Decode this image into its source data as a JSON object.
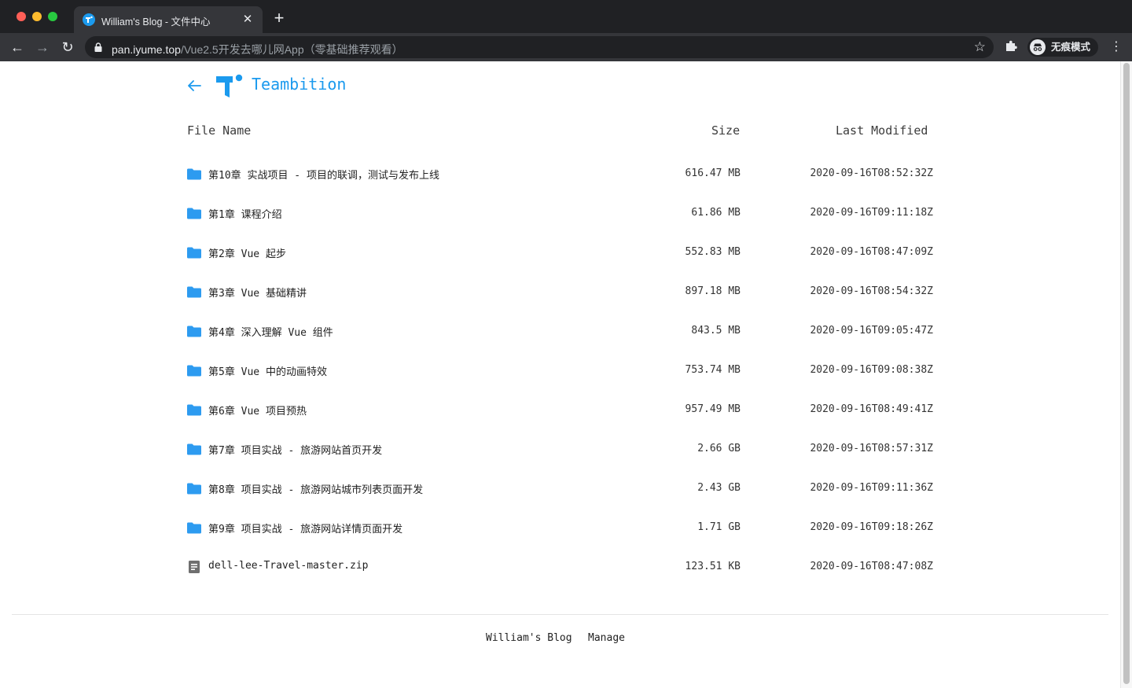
{
  "browser": {
    "tab_title": "William's Blog - 文件中心",
    "tab_close": "✕",
    "new_tab": "+",
    "url_host": "pan.iyume.top",
    "url_path": "/Vue2.5开发去哪儿网App（零基础推荐观看）",
    "incognito_label": "无痕模式",
    "back_glyph": "←",
    "forward_glyph": "→",
    "reload_glyph": "↻",
    "star_glyph": "☆",
    "menu_glyph": "⋮"
  },
  "header": {
    "brand": "Teambition",
    "accent_color": "#1b9aee"
  },
  "table": {
    "col_name": "File Name",
    "col_size": "Size",
    "col_modified": "Last Modified"
  },
  "files": [
    {
      "name": "第10章 实战项目 - 项目的联调，测试与发布上线",
      "size": "616.47 MB",
      "modified": "2020-09-16T08:52:32Z",
      "type": "folder"
    },
    {
      "name": "第1章 课程介绍",
      "size": "61.86 MB",
      "modified": "2020-09-16T09:11:18Z",
      "type": "folder"
    },
    {
      "name": "第2章 Vue 起步",
      "size": "552.83 MB",
      "modified": "2020-09-16T08:47:09Z",
      "type": "folder"
    },
    {
      "name": "第3章 Vue 基础精讲",
      "size": "897.18 MB",
      "modified": "2020-09-16T08:54:32Z",
      "type": "folder"
    },
    {
      "name": "第4章 深入理解 Vue 组件",
      "size": "843.5 MB",
      "modified": "2020-09-16T09:05:47Z",
      "type": "folder"
    },
    {
      "name": "第5章 Vue 中的动画特效",
      "size": "753.74 MB",
      "modified": "2020-09-16T09:08:38Z",
      "type": "folder"
    },
    {
      "name": "第6章 Vue 项目预热",
      "size": "957.49 MB",
      "modified": "2020-09-16T08:49:41Z",
      "type": "folder"
    },
    {
      "name": "第7章 项目实战 - 旅游网站首页开发",
      "size": "2.66 GB",
      "modified": "2020-09-16T08:57:31Z",
      "type": "folder"
    },
    {
      "name": "第8章 项目实战 - 旅游网站城市列表页面开发",
      "size": "2.43 GB",
      "modified": "2020-09-16T09:11:36Z",
      "type": "folder"
    },
    {
      "name": "第9章 项目实战 - 旅游网站详情页面开发",
      "size": "1.71 GB",
      "modified": "2020-09-16T09:18:26Z",
      "type": "folder"
    },
    {
      "name": "dell-lee-Travel-master.zip",
      "size": "123.51 KB",
      "modified": "2020-09-16T08:47:08Z",
      "type": "file"
    }
  ],
  "footer": {
    "blog_link": "William's Blog",
    "manage_link": "Manage"
  }
}
